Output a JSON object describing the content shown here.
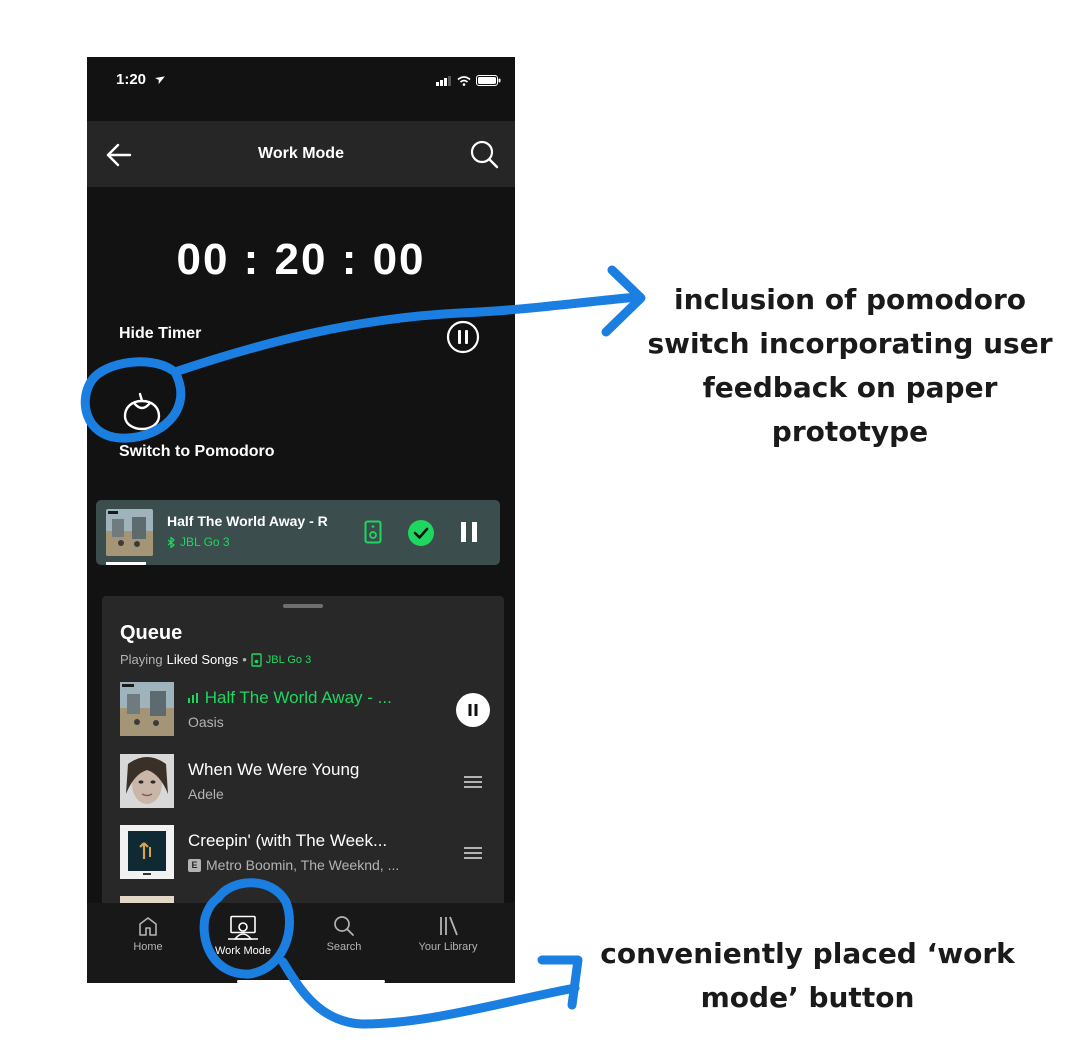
{
  "colors": {
    "accent": "#1ed760",
    "annotation_blue": "#1a7fe0",
    "background": "#121212",
    "now_playing_bg": "#3b4d4d"
  },
  "status_bar": {
    "time": "1:20"
  },
  "header": {
    "title": "Work Mode",
    "back_icon": "arrow-left-icon",
    "search_icon": "search-icon"
  },
  "timer": {
    "display": "00 : 20 : 00",
    "hide_label": "Hide Timer",
    "pause_icon": "pause-circle-icon"
  },
  "pomodoro": {
    "label": "Switch to Pomodoro",
    "icon": "tomato-icon"
  },
  "now_playing": {
    "title": "Half The World Away - R",
    "device": "JBL Go 3",
    "progress": 0.1
  },
  "queue": {
    "title": "Queue",
    "playing_prefix": "Playing",
    "playlist": "Liked Songs",
    "separator": "•",
    "device": "JBL Go 3",
    "items": [
      {
        "title": "Half The World Away - ...",
        "artist": "Oasis",
        "playing": true
      },
      {
        "title": "When We Were Young",
        "artist": "Adele",
        "playing": false
      },
      {
        "title": "Creepin' (with The Week...",
        "artist": "Metro Boomin, The Weeknd, ...",
        "explicit": true,
        "playing": false
      }
    ],
    "explicit_badge": "E"
  },
  "tabs": [
    {
      "label": "Home",
      "icon": "home-icon"
    },
    {
      "label": "Work Mode",
      "icon": "work-mode-icon"
    },
    {
      "label": "Search",
      "icon": "search-icon"
    },
    {
      "label": "Your Library",
      "icon": "library-icon"
    }
  ],
  "annotations": {
    "pomodoro_note": "inclusion of pomodoro switch incorporating user feedback on paper prototype",
    "work_mode_note": "conveniently placed ‘work mode’ button"
  }
}
